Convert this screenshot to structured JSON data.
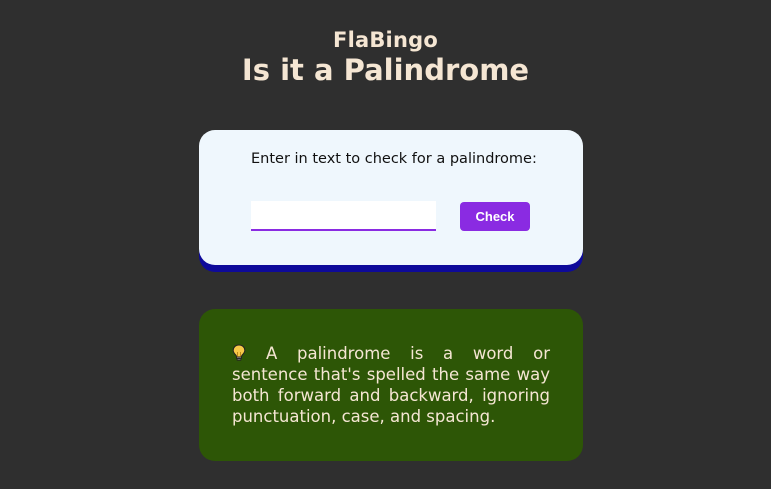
{
  "header": {
    "brand": "FlaBingo",
    "title": "Is it a Palindrome"
  },
  "checker": {
    "prompt": "Enter in text to check for a palindrome:",
    "input_value": "",
    "input_placeholder": "",
    "check_label": "Check"
  },
  "info": {
    "icon": "lightbulb-icon",
    "text": "A palindrome is a word or sentence that's spelled the same way both forward and backward, ignoring punctuation, case, and spacing."
  },
  "colors": {
    "background": "#2f2f2f",
    "heading": "#f5e6d3",
    "card": "#eff7fd",
    "card_shadow": "#0e0a9a",
    "accent": "#8a2be2",
    "info_card": "#2d5606"
  }
}
